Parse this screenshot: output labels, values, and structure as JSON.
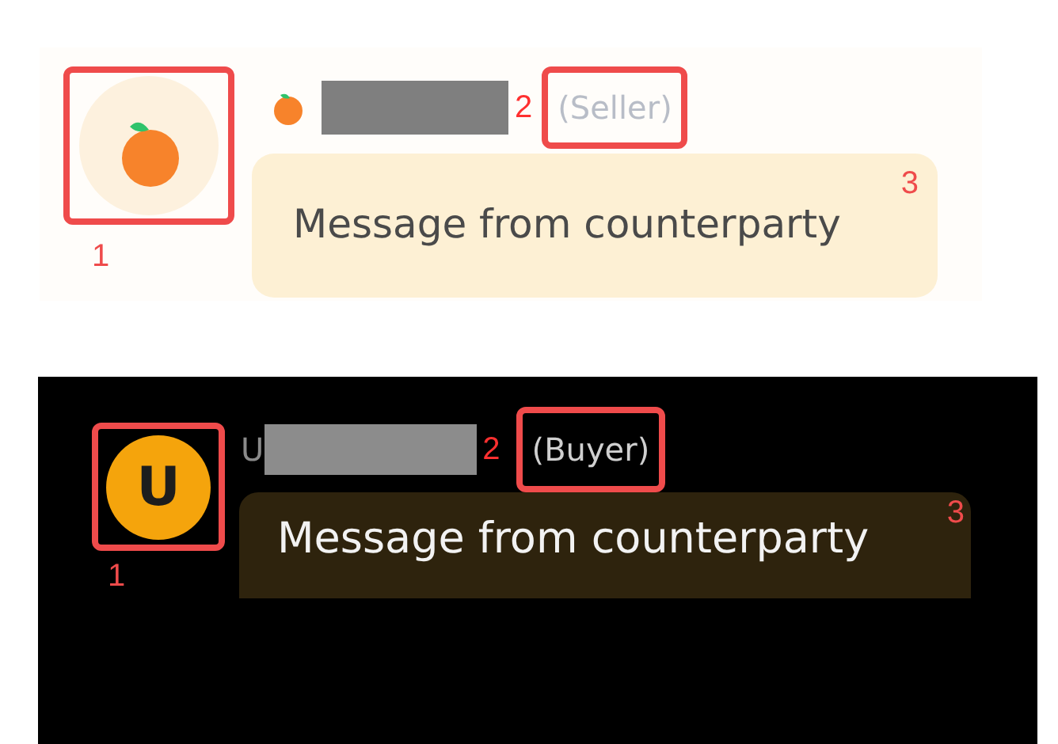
{
  "panels": [
    {
      "kind": "light",
      "avatar": {
        "kind": "fruit",
        "annotation": "1"
      },
      "sender": {
        "role": "(Seller)",
        "annotation": "2"
      },
      "message": {
        "text": "Message from counterparty",
        "annotation": "3"
      }
    },
    {
      "kind": "dark",
      "avatar": {
        "kind": "letter",
        "letter": "U",
        "annotation": "1"
      },
      "sender": {
        "name_prefix": "U",
        "role": "(Buyer)",
        "annotation": "2"
      },
      "message": {
        "text": "Message from counterparty",
        "annotation": "3"
      }
    }
  ]
}
